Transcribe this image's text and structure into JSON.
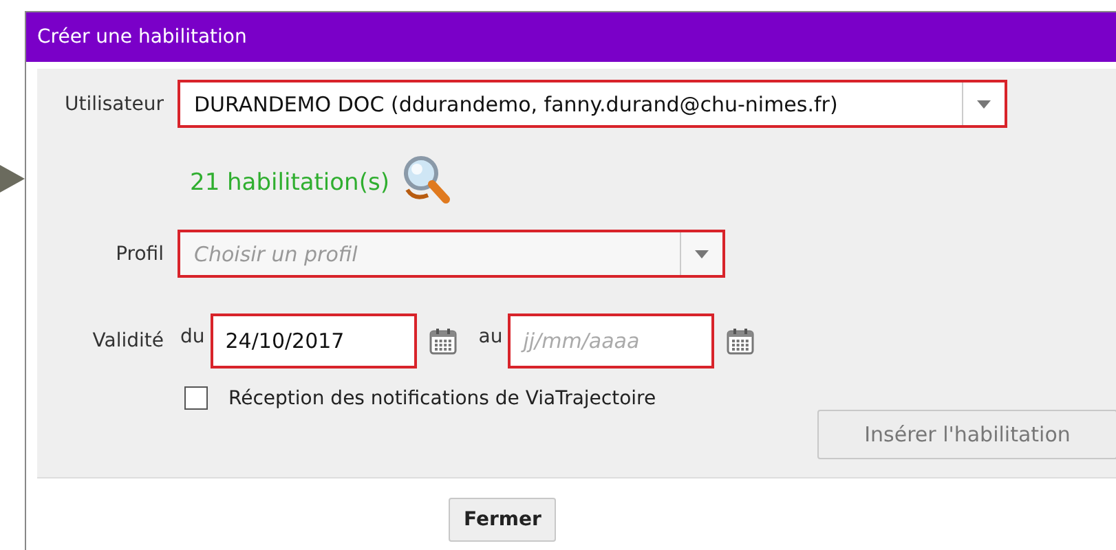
{
  "window": {
    "title": "Créer une habilitation"
  },
  "user": {
    "label": "Utilisateur",
    "value": "DURANDEMO DOC (ddurandemo, fanny.durand@chu-nimes.fr)",
    "invalid": true
  },
  "count": {
    "text": "21 habilitation(s)"
  },
  "profile": {
    "label": "Profil",
    "placeholder": "Choisir un profil",
    "invalid": true
  },
  "validity": {
    "label": "Validité",
    "from_label": "du",
    "from_value": "24/10/2017",
    "from_invalid": true,
    "to_label": "au",
    "to_placeholder": "jj/mm/aaaa",
    "to_invalid": true
  },
  "notifications": {
    "label": "Réception des notifications de ViaTrajectoire",
    "checked": false
  },
  "insert_button": {
    "label": "Insérer l'habilitation",
    "disabled": true
  },
  "close_button": {
    "label": "Fermer"
  }
}
